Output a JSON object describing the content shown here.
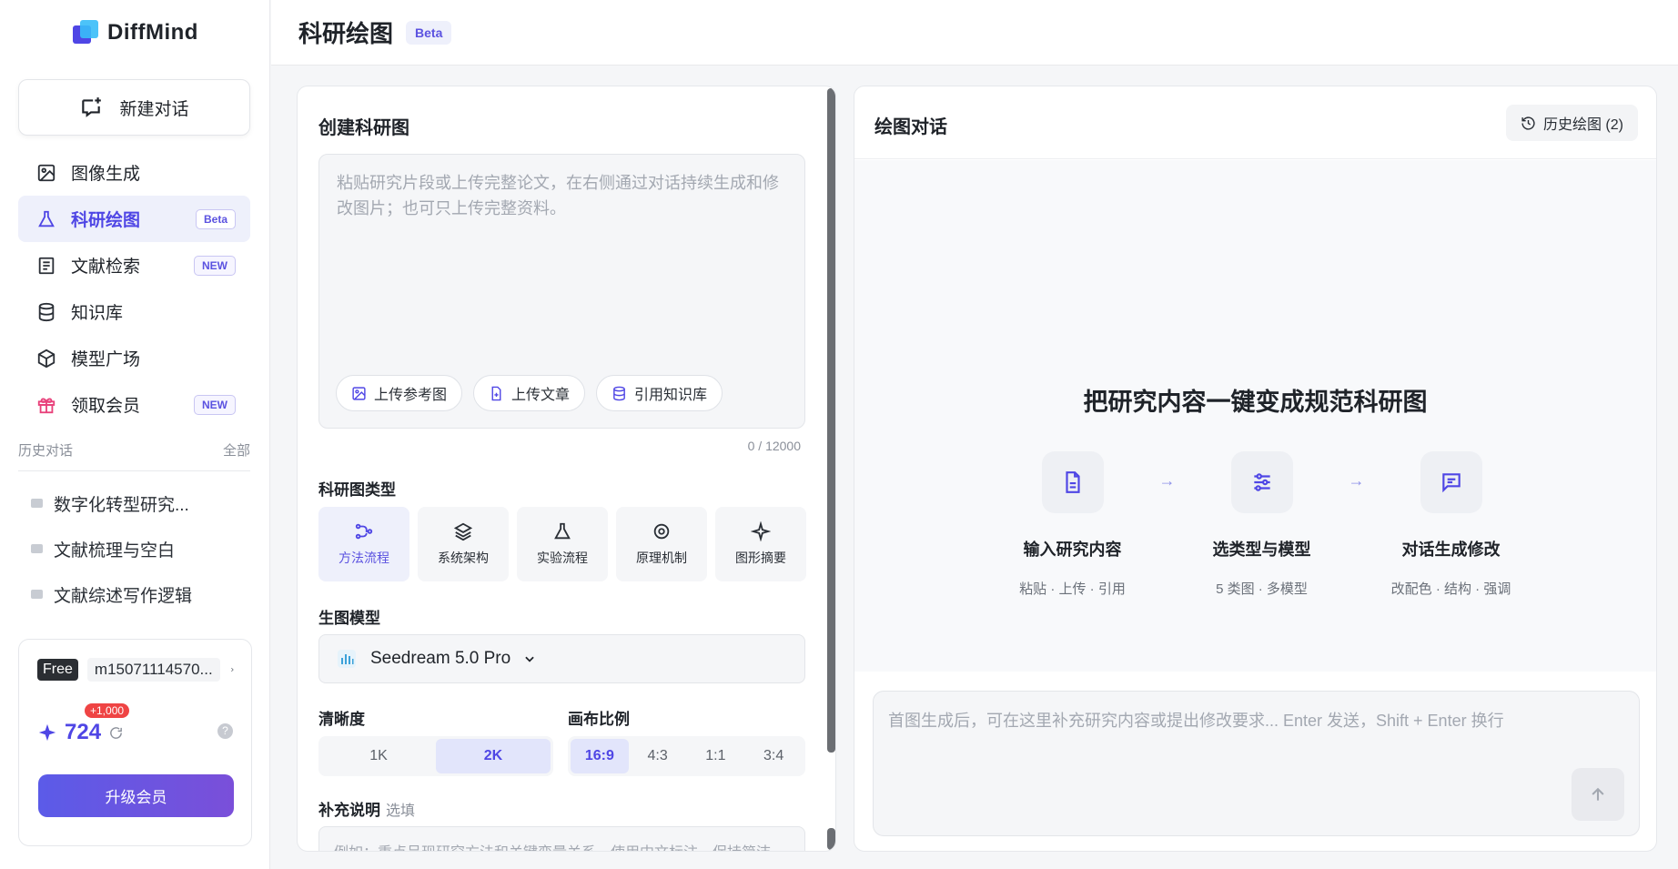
{
  "app": {
    "name": "DiffMind"
  },
  "sidebar": {
    "new_chat": "新建对话",
    "items": [
      {
        "label": "图像生成",
        "icon": "image-icon",
        "badge": ""
      },
      {
        "label": "科研绘图",
        "icon": "flask-icon",
        "badge": "Beta",
        "active": true
      },
      {
        "label": "文献检索",
        "icon": "document-icon",
        "badge": "NEW"
      },
      {
        "label": "知识库",
        "icon": "database-icon",
        "badge": ""
      },
      {
        "label": "模型广场",
        "icon": "cube-icon",
        "badge": ""
      },
      {
        "label": "领取会员",
        "icon": "gift-icon",
        "badge": "NEW"
      }
    ],
    "history_title": "历史对话",
    "history_all": "全部",
    "history": [
      "数字化转型研究...",
      "文献梳理与空白",
      "文献综述写作逻辑"
    ],
    "account": {
      "plan": "Free",
      "username": "m15071114570...",
      "credits": "724",
      "bonus": "+1,000",
      "help": "?",
      "upgrade": "升级会员"
    }
  },
  "header": {
    "title": "科研绘图",
    "badge": "Beta"
  },
  "left_panel": {
    "title": "创建科研图",
    "placeholder": "粘贴研究片段或上传完整论文，在右侧通过对话持续生成和修改图片；也可只上传完整资料。",
    "chips": [
      "上传参考图",
      "上传文章",
      "引用知识库"
    ],
    "counter": "0 / 12000",
    "type_label": "科研图类型",
    "types": [
      {
        "label": "方法流程",
        "icon": "flow-icon",
        "active": true
      },
      {
        "label": "系统架构",
        "icon": "layers-icon"
      },
      {
        "label": "实验流程",
        "icon": "flask-icon"
      },
      {
        "label": "原理机制",
        "icon": "target-icon"
      },
      {
        "label": "图形摘要",
        "icon": "sparkle-icon"
      }
    ],
    "model_label": "生图模型",
    "model": "Seedream 5.0 Pro",
    "resolution_label": "清晰度",
    "resolutions": [
      "1K",
      "2K"
    ],
    "resolution_selected": "2K",
    "ratio_label": "画布比例",
    "ratios": [
      "16:9",
      "4:3",
      "1:1",
      "3:4"
    ],
    "ratio_selected": "16:9",
    "note_label": "补充说明",
    "note_optional": "选填",
    "note_placeholder": "例如：重点呈现研究方法和关键变量关系，使用中文标注，保持简洁..."
  },
  "right_panel": {
    "title": "绘图对话",
    "history_button": "历史绘图 (2)",
    "hero": "把研究内容一键变成规范科研图",
    "steps": [
      {
        "title": "输入研究内容",
        "sub": "粘贴 · 上传 · 引用",
        "icon": "file-text-icon"
      },
      {
        "title": "选类型与模型",
        "sub": "5 类图 · 多模型",
        "icon": "sliders-icon"
      },
      {
        "title": "对话生成修改",
        "sub": "改配色 · 结构 · 强调",
        "icon": "chat-icon"
      }
    ],
    "composer_placeholder": "首图生成后，可在这里补充研究内容或提出修改要求...   Enter 发送，Shift + Enter 换行"
  },
  "colors": {
    "accent": "#4f46e5",
    "accent_light": "#eef0fb",
    "upgrade_start": "#5b5be8",
    "upgrade_end": "#7a4fd9",
    "bonus": "#ef4444"
  }
}
